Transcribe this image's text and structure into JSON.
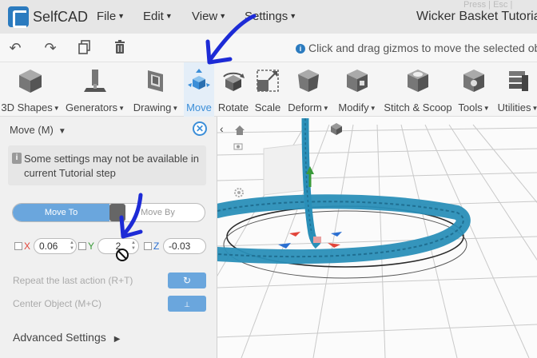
{
  "app": {
    "name": "SelfCAD",
    "tutorial_title": "Wicker Basket Tutorial",
    "press_esc": "Press | Esc |"
  },
  "menu": [
    {
      "label": "File"
    },
    {
      "label": "Edit"
    },
    {
      "label": "View"
    },
    {
      "label": "Settings"
    }
  ],
  "quick_actions": {
    "hint": "Click and drag gizmos to move the selected object"
  },
  "toolbar": [
    {
      "label": "3D Shapes",
      "dropdown": true,
      "icon": "cube-icon"
    },
    {
      "label": "Generators",
      "dropdown": true,
      "icon": "generator-icon"
    },
    {
      "label": "Drawing",
      "dropdown": true,
      "icon": "drawing-icon"
    },
    {
      "label": "Move",
      "dropdown": false,
      "icon": "move-icon",
      "active": true
    },
    {
      "label": "Rotate",
      "dropdown": false,
      "icon": "rotate-icon"
    },
    {
      "label": "Scale",
      "dropdown": false,
      "icon": "scale-icon"
    },
    {
      "label": "Deform",
      "dropdown": true,
      "icon": "deform-icon"
    },
    {
      "label": "Modify",
      "dropdown": true,
      "icon": "modify-icon"
    },
    {
      "label": "Stitch & Scoop",
      "dropdown": false,
      "icon": "stitch-scoop-icon"
    },
    {
      "label": "Tools",
      "dropdown": true,
      "icon": "tools-icon"
    },
    {
      "label": "Utilities",
      "dropdown": true,
      "icon": "utilities-icon"
    }
  ],
  "panel": {
    "title": "Move (M)",
    "notice": "Some settings may not be available in current Tutorial step",
    "mode_tabs": {
      "active": "Move To",
      "inactive": "Move By"
    },
    "axes": [
      {
        "label": "X",
        "value": "0.06",
        "color": "#e2453b"
      },
      {
        "label": "Y",
        "value": "2",
        "color": "#3a9a3a"
      },
      {
        "label": "Z",
        "value": "-0.03",
        "color": "#2b6fd1"
      }
    ],
    "repeat_label": "Repeat the last action (R+T)",
    "center_label": "Center Object (M+C)",
    "advanced_label": "Advanced Settings"
  },
  "colors": {
    "accent": "#3b8ed8",
    "annotation": "#1d2bd6",
    "basket": "#2a8fb8"
  }
}
